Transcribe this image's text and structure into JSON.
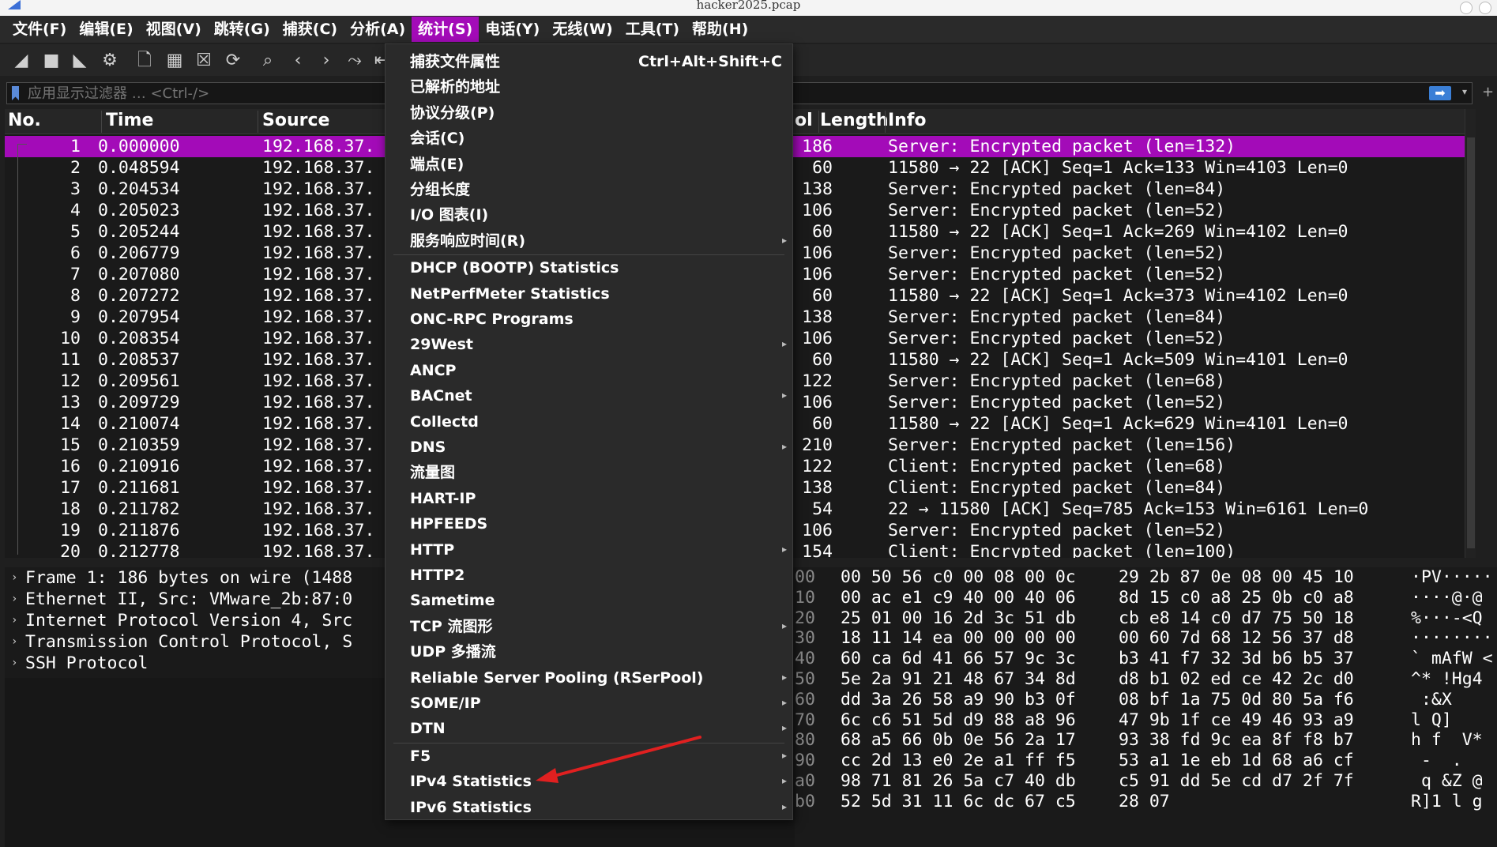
{
  "window": {
    "title": "hacker2025.pcap"
  },
  "menubar": [
    "文件(F)",
    "编辑(E)",
    "视图(V)",
    "跳转(G)",
    "捕获(C)",
    "分析(A)",
    "统计(S)",
    "电话(Y)",
    "无线(W)",
    "工具(T)",
    "帮助(H)"
  ],
  "menubar_active": "统计(S)",
  "filter": {
    "placeholder": "应用显示过滤器 … <Ctrl-/>"
  },
  "columns": {
    "no": "No.",
    "time": "Time",
    "source": "Source",
    "protocol_fragment": "ol",
    "length": "Length",
    "info": "Info"
  },
  "packets": [
    {
      "no": "1",
      "time": "0.000000",
      "src": "192.168.37.",
      "len": "186",
      "info": "Server: Encrypted packet (len=132)"
    },
    {
      "no": "2",
      "time": "0.048594",
      "src": "192.168.37.",
      "len": "60",
      "info": "11580 → 22 [ACK] Seq=1 Ack=133 Win=4103 Len=0"
    },
    {
      "no": "3",
      "time": "0.204534",
      "src": "192.168.37.",
      "len": "138",
      "info": "Server: Encrypted packet (len=84)"
    },
    {
      "no": "4",
      "time": "0.205023",
      "src": "192.168.37.",
      "len": "106",
      "info": "Server: Encrypted packet (len=52)"
    },
    {
      "no": "5",
      "time": "0.205244",
      "src": "192.168.37.",
      "len": "60",
      "info": "11580 → 22 [ACK] Seq=1 Ack=269 Win=4102 Len=0"
    },
    {
      "no": "6",
      "time": "0.206779",
      "src": "192.168.37.",
      "len": "106",
      "info": "Server: Encrypted packet (len=52)"
    },
    {
      "no": "7",
      "time": "0.207080",
      "src": "192.168.37.",
      "len": "106",
      "info": "Server: Encrypted packet (len=52)"
    },
    {
      "no": "8",
      "time": "0.207272",
      "src": "192.168.37.",
      "len": "60",
      "info": "11580 → 22 [ACK] Seq=1 Ack=373 Win=4102 Len=0"
    },
    {
      "no": "9",
      "time": "0.207954",
      "src": "192.168.37.",
      "len": "138",
      "info": "Server: Encrypted packet (len=84)"
    },
    {
      "no": "10",
      "time": "0.208354",
      "src": "192.168.37.",
      "len": "106",
      "info": "Server: Encrypted packet (len=52)"
    },
    {
      "no": "11",
      "time": "0.208537",
      "src": "192.168.37.",
      "len": "60",
      "info": "11580 → 22 [ACK] Seq=1 Ack=509 Win=4101 Len=0"
    },
    {
      "no": "12",
      "time": "0.209561",
      "src": "192.168.37.",
      "len": "122",
      "info": "Server: Encrypted packet (len=68)"
    },
    {
      "no": "13",
      "time": "0.209729",
      "src": "192.168.37.",
      "len": "106",
      "info": "Server: Encrypted packet (len=52)"
    },
    {
      "no": "14",
      "time": "0.210074",
      "src": "192.168.37.",
      "len": "60",
      "info": "11580 → 22 [ACK] Seq=1 Ack=629 Win=4101 Len=0"
    },
    {
      "no": "15",
      "time": "0.210359",
      "src": "192.168.37.",
      "len": "210",
      "info": "Server: Encrypted packet (len=156)"
    },
    {
      "no": "16",
      "time": "0.210916",
      "src": "192.168.37.",
      "len": "122",
      "info": "Client: Encrypted packet (len=68)"
    },
    {
      "no": "17",
      "time": "0.211681",
      "src": "192.168.37.",
      "len": "138",
      "info": "Client: Encrypted packet (len=84)"
    },
    {
      "no": "18",
      "time": "0.211782",
      "src": "192.168.37.",
      "len": "54",
      "info": "22 → 11580 [ACK] Seq=785 Ack=153 Win=6161 Len=0"
    },
    {
      "no": "19",
      "time": "0.211876",
      "src": "192.168.37.",
      "len": "106",
      "info": "Server: Encrypted packet (len=52)"
    },
    {
      "no": "20",
      "time": "0.212778",
      "src": "192.168.37.",
      "len": "154",
      "info": "Client: Encrypted packet (len=100)"
    }
  ],
  "selected_packet": "1",
  "details": [
    "Frame 1: 186 bytes on wire (1488",
    "Ethernet II, Src: VMware_2b:87:0",
    "Internet Protocol Version 4, Src",
    "Transmission Control Protocol, S",
    "SSH Protocol"
  ],
  "bytes": [
    {
      "off": "00",
      "h1": "00 50 56 c0 00 08 00 0c",
      "h2": "29 2b 87 0e 08 00 45 10",
      "asc": "·PV·····"
    },
    {
      "off": "10",
      "h1": "00 ac e1 c9 40 00 40 06",
      "h2": "8d 15 c0 a8 25 0b c0 a8",
      "asc": "····@·@"
    },
    {
      "off": "20",
      "h1": "25 01 00 16 2d 3c 51 db",
      "h2": "cb e8 14 c0 d7 75 50 18",
      "asc": "%···-<Q"
    },
    {
      "off": "30",
      "h1": "18 11 14 ea 00 00 00 00",
      "h2": "00 60 7d 68 12 56 37 d8",
      "asc": "········"
    },
    {
      "off": "40",
      "h1": "60 ca 6d 41 66 57 9c 3c",
      "h2": "b3 41 f7 32 3d b6 b5 37",
      "asc": "` mAfW <"
    },
    {
      "off": "50",
      "h1": "5e 2a 91 21 48 67 34 8d",
      "h2": "d8 b1 02 ed ce 42 2c d0",
      "asc": "^* !Hg4"
    },
    {
      "off": "60",
      "h1": "dd 3a 26 58 a9 90 b3 0f",
      "h2": "08 bf 1a 75 0d 80 5a f6",
      "asc": " :&X"
    },
    {
      "off": "70",
      "h1": "6c c6 51 5d d9 88 a8 96",
      "h2": "47 9b 1f ce 49 46 93 a9",
      "asc": "l Q]"
    },
    {
      "off": "80",
      "h1": "68 a5 66 0b 0e 56 2a 17",
      "h2": "93 38 fd 9c ea 8f f8 b7",
      "asc": "h f  V*"
    },
    {
      "off": "90",
      "h1": "cc 2d 13 e0 2e a1 ff f5",
      "h2": "53 a1 1e eb 1d 68 a6 cf",
      "asc": " -  . "
    },
    {
      "off": "a0",
      "h1": "98 71 81 26 5a c7 40 db",
      "h2": "c5 91 dd 5e cd d7 2f 7f",
      "asc": " q &Z @"
    },
    {
      "off": "b0",
      "h1": "52 5d 31 11 6c dc 67 c5",
      "h2": "28 07",
      "asc": "R]1 l g"
    }
  ],
  "stats_menu": {
    "items": [
      {
        "label": "捕获文件属性",
        "shortcut": "Ctrl+Alt+Shift+C",
        "submenu": false
      },
      {
        "label": "已解析的地址",
        "submenu": false
      },
      {
        "label": "协议分级(P)",
        "submenu": false
      },
      {
        "label": "会话(C)",
        "submenu": false
      },
      {
        "label": "端点(E)",
        "submenu": false
      },
      {
        "label": "分组长度",
        "submenu": false
      },
      {
        "label": "I/O 图表(I)",
        "submenu": false
      },
      {
        "label": "服务响应时间(R)",
        "submenu": true
      },
      {
        "label": "DHCP (BOOTP) Statistics",
        "submenu": false,
        "sep_before": true
      },
      {
        "label": "NetPerfMeter Statistics",
        "submenu": false
      },
      {
        "label": "ONC-RPC Programs",
        "submenu": false
      },
      {
        "label": "29West",
        "submenu": true
      },
      {
        "label": "ANCP",
        "submenu": false
      },
      {
        "label": "BACnet",
        "submenu": true
      },
      {
        "label": "Collectd",
        "submenu": false
      },
      {
        "label": "DNS",
        "submenu": true
      },
      {
        "label": "流量图",
        "submenu": false
      },
      {
        "label": "HART-IP",
        "submenu": false
      },
      {
        "label": "HPFEEDS",
        "submenu": false
      },
      {
        "label": "HTTP",
        "submenu": true
      },
      {
        "label": "HTTP2",
        "submenu": false
      },
      {
        "label": "Sametime",
        "submenu": false
      },
      {
        "label": "TCP 流图形",
        "submenu": true
      },
      {
        "label": "UDP 多播流",
        "submenu": false
      },
      {
        "label": "Reliable Server Pooling (RSerPool)",
        "submenu": true
      },
      {
        "label": "SOME/IP",
        "submenu": true
      },
      {
        "label": "DTN",
        "submenu": true
      },
      {
        "label": "F5",
        "submenu": true,
        "sep_before": true
      },
      {
        "label": "IPv4 Statistics",
        "submenu": true
      },
      {
        "label": "IPv6 Statistics",
        "submenu": true
      }
    ]
  },
  "colors": {
    "accent": "#a30bb8",
    "annotation": "#e02020"
  }
}
